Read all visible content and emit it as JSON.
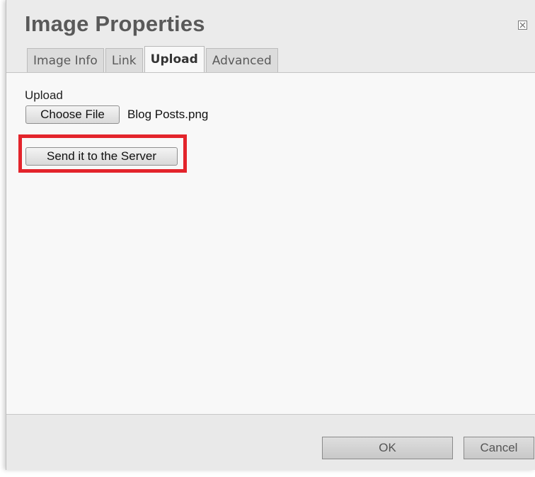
{
  "dialog": {
    "title": "Image Properties",
    "close_icon": "close-icon"
  },
  "tabs": [
    {
      "label": "Image Info",
      "active": false
    },
    {
      "label": "Link",
      "active": false
    },
    {
      "label": "Upload",
      "active": true
    },
    {
      "label": "Advanced",
      "active": false
    }
  ],
  "upload": {
    "label": "Upload",
    "choose_file_label": "Choose File",
    "file_name": "Blog Posts.png",
    "send_button_label": "Send it to the Server",
    "highlight_color": "#e3242b"
  },
  "footer": {
    "ok_label": "OK",
    "cancel_label": "Cancel"
  }
}
